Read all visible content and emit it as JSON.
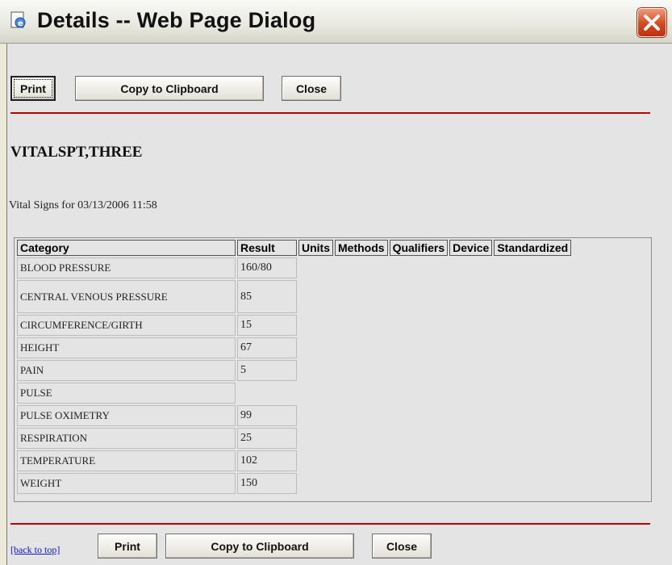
{
  "window": {
    "title": "Details -- Web Page Dialog",
    "icon": "ie-page-icon",
    "close_icon": "close-icon"
  },
  "toolbar_top": {
    "print_label": "Print",
    "copy_label": "Copy to Clipboard",
    "close_label": "Close"
  },
  "patient_name": "VITALSPT,THREE",
  "vitals_caption": "Vital Signs for 03/13/2006 11:58",
  "table": {
    "headers": [
      "Category",
      "Result",
      "Units",
      "Methods",
      "Qualifiers",
      "Device",
      "Standardized"
    ],
    "rows": [
      {
        "category": "BLOOD PRESSURE",
        "result": "160/80"
      },
      {
        "category": "CENTRAL VENOUS PRESSURE",
        "result": "85"
      },
      {
        "category": "CIRCUMFERENCE/GIRTH",
        "result": "15"
      },
      {
        "category": "HEIGHT",
        "result": "67"
      },
      {
        "category": "PAIN",
        "result": "5"
      },
      {
        "category": "PULSE",
        "result": ""
      },
      {
        "category": "PULSE OXIMETRY",
        "result": "99"
      },
      {
        "category": "RESPIRATION",
        "result": "25"
      },
      {
        "category": "TEMPERATURE",
        "result": "102"
      },
      {
        "category": "WEIGHT",
        "result": "150"
      }
    ]
  },
  "footer": {
    "back_to_top": "[back to top]",
    "print_label": "Print",
    "copy_label": "Copy to Clipboard",
    "close_label": "Close"
  },
  "colors": {
    "rule": "#c00000",
    "link": "#1010d0",
    "close_button": "#d8481c"
  }
}
